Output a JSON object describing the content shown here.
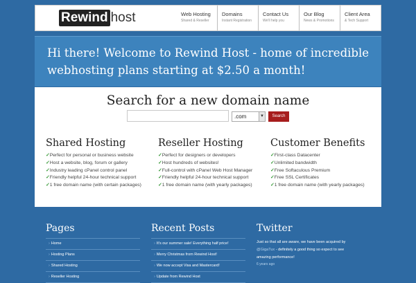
{
  "brand": {
    "logo_box": "Rewind",
    "logo_rest": "host"
  },
  "nav": [
    {
      "title": "Web Hosting",
      "sub": "Shared & Reseller"
    },
    {
      "title": "Domains",
      "sub": "Instant Registration"
    },
    {
      "title": "Contact Us",
      "sub": "We'll help you"
    },
    {
      "title": "Our Blog",
      "sub": "News & Promotions"
    },
    {
      "title": "Client Area",
      "sub": "& Tech Support"
    }
  ],
  "hero": {
    "text": "Hi there! Welcome to Rewind Host - home of incredible webhosting plans starting at $2.50 a month!"
  },
  "search": {
    "title": "Search for a new domain name",
    "input_value": "",
    "tld": ".com",
    "button": "Search"
  },
  "columns": [
    {
      "title": "Shared Hosting",
      "items": [
        "Perfect for personal or business website",
        "Host a website, blog, forum or gallery",
        "Industry leading cPanel control panel",
        "Friendly helpful 24-hour technical support",
        "1 free domain name (with certain packages)"
      ]
    },
    {
      "title": "Reseller Hosting",
      "items": [
        "Perfect for designers or developers",
        "Host hundreds of websites!",
        "Full-control with cPanel Web Host Manager",
        "Friendly helpful 24-hour technical support",
        "1 free domain name (with yearly packages)"
      ]
    },
    {
      "title": "Customer Benefits",
      "items": [
        "First-class Datacenter",
        "Unlimited bandwidth",
        "Free Softaculous Premium",
        "Free SSL Certificates",
        "1 free domain name (with yearly packages)"
      ]
    }
  ],
  "footer": {
    "pages": {
      "title": "Pages",
      "items": [
        "Home",
        "Hosting Plans",
        "Shared Hosting",
        "Reseller Hosting"
      ]
    },
    "recent": {
      "title": "Recent Posts",
      "items": [
        "It's our summer sale! Everything half price!",
        "Merry Christmas from Rewind Host!",
        "We now accept Visa and Mastercard!",
        "Update from Rewind Host"
      ]
    },
    "twitter": {
      "title": "Twitter",
      "tweet_before": "Just so that all are aware, we have been acquired by ",
      "tweet_handle": "@GigaTux",
      "tweet_after": " - definitely a good thing so expect to see amazing performance!",
      "time": "6 years ago"
    }
  }
}
